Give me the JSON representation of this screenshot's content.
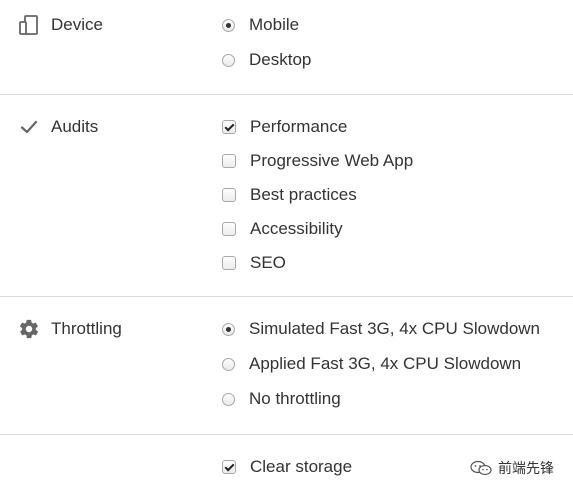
{
  "device": {
    "title": "Device",
    "icon": "device-icon",
    "options": [
      {
        "label": "Mobile",
        "checked": true
      },
      {
        "label": "Desktop",
        "checked": false
      }
    ]
  },
  "audits": {
    "title": "Audits",
    "icon": "checkmark-icon",
    "options": [
      {
        "label": "Performance",
        "checked": true
      },
      {
        "label": "Progressive Web App",
        "checked": false
      },
      {
        "label": "Best practices",
        "checked": false
      },
      {
        "label": "Accessibility",
        "checked": false
      },
      {
        "label": "SEO",
        "checked": false
      }
    ]
  },
  "throttling": {
    "title": "Throttling",
    "icon": "gear-icon",
    "options": [
      {
        "label": "Simulated Fast 3G, 4x CPU Slowdown",
        "checked": true
      },
      {
        "label": "Applied Fast 3G, 4x CPU Slowdown",
        "checked": false
      },
      {
        "label": "No throttling",
        "checked": false
      }
    ]
  },
  "storage": {
    "options": [
      {
        "label": "Clear storage",
        "checked": true
      }
    ]
  },
  "watermark": {
    "text": "前端先锋",
    "icon": "wechat-icon"
  }
}
